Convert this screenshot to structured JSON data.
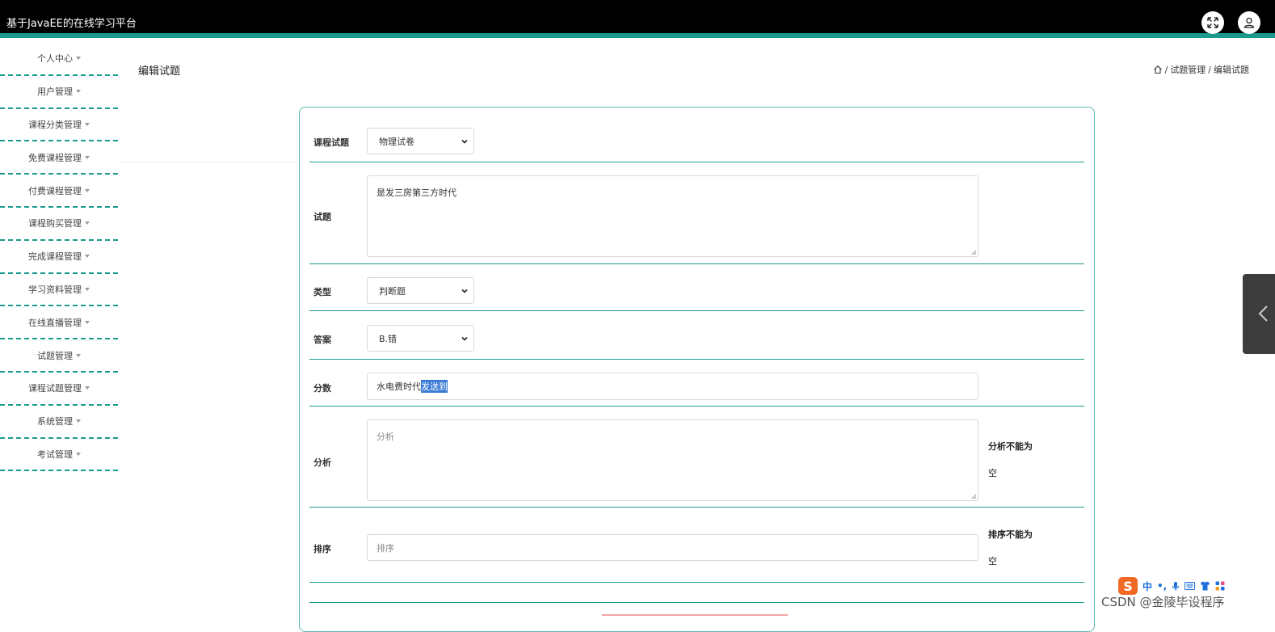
{
  "header": {
    "title": "基于JavaEE的在线学习平台"
  },
  "sidebar": {
    "items": [
      {
        "label": "个人中心"
      },
      {
        "label": "用户管理"
      },
      {
        "label": "课程分类管理"
      },
      {
        "label": "免费课程管理"
      },
      {
        "label": "付费课程管理"
      },
      {
        "label": "课程购买管理"
      },
      {
        "label": "完成课程管理"
      },
      {
        "label": "学习资料管理"
      },
      {
        "label": "在线直播管理"
      },
      {
        "label": "试题管理"
      },
      {
        "label": "课程试题管理"
      },
      {
        "label": "系统管理"
      },
      {
        "label": "考试管理"
      }
    ]
  },
  "page": {
    "title": "编辑试题"
  },
  "breadcrumb": {
    "sep1": "/",
    "item1": "试题管理",
    "sep2": "/",
    "item2": "编辑试题"
  },
  "form": {
    "course_exam": {
      "label": "课程试题",
      "value": "物理试卷"
    },
    "question": {
      "label": "试题",
      "value": "是发三房第三方时代"
    },
    "type": {
      "label": "类型",
      "value": "判断题"
    },
    "answer": {
      "label": "答案",
      "value": "B.错"
    },
    "score": {
      "label": "分数",
      "value_plain": "水电费时代",
      "value_selected": "发送到"
    },
    "analysis": {
      "label": "分析",
      "placeholder": "分析",
      "error_line1": "分析不能为",
      "error_line2": "空"
    },
    "order": {
      "label": "排序",
      "placeholder": "排序",
      "error_line1": "排序不能为",
      "error_line2": "空"
    }
  },
  "ime": {
    "lang": "中",
    "punct": "•,",
    "logo": "S"
  },
  "watermark": "CSDN @金陵毕设程序"
}
